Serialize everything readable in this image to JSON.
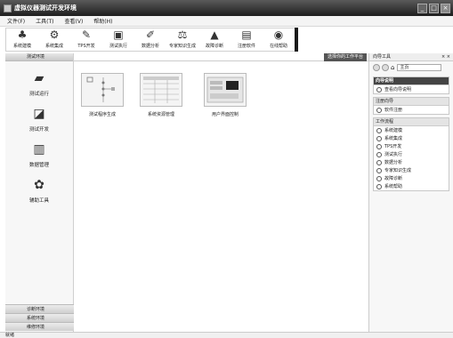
{
  "window": {
    "title": "虚拟仪器测试开发环境",
    "controls": [
      "_",
      "□",
      "×"
    ]
  },
  "menu": [
    "文件(F)",
    "工具(T)",
    "查看(V)",
    "帮助(H)"
  ],
  "toolbar": [
    {
      "label": "系统建模",
      "icon": "modeling-icon",
      "glyph": "♣"
    },
    {
      "label": "系统集成",
      "icon": "integration-icon",
      "glyph": "⚙"
    },
    {
      "label": "TPS开发",
      "icon": "tps-icon",
      "glyph": "✎"
    },
    {
      "label": "测试执行",
      "icon": "execute-icon",
      "glyph": "▣"
    },
    {
      "label": "数据分析",
      "icon": "analysis-icon",
      "glyph": "✐"
    },
    {
      "label": "专家知识生成",
      "icon": "expert-icon",
      "glyph": "⚖"
    },
    {
      "label": "故障诊断",
      "icon": "diagnosis-icon",
      "glyph": "▲"
    },
    {
      "label": "注册软件",
      "icon": "register-icon",
      "glyph": "▤"
    },
    {
      "label": "在线帮助",
      "icon": "help-icon",
      "glyph": "◉"
    }
  ],
  "sidebar": {
    "header": "测试环境",
    "items": [
      {
        "label": "测试运行",
        "icon": "run-icon",
        "glyph": "▰"
      },
      {
        "label": "测试开发",
        "icon": "develop-icon",
        "glyph": "◪"
      },
      {
        "label": "数据管理",
        "icon": "data-icon",
        "glyph": "▥"
      },
      {
        "label": "辅助工具",
        "icon": "tools-icon",
        "glyph": "✿"
      }
    ],
    "footers": [
      "诊断环境",
      "系统环境",
      "维修环境"
    ]
  },
  "main": {
    "tab": "选择你的工作平台",
    "cards": [
      "测试程序生成",
      "系统资源管理",
      "用户界面控制"
    ]
  },
  "tasks": {
    "header": "向导工具",
    "home_label": "主页",
    "wizard": {
      "title": "向导说明",
      "items": [
        "查看向导说明"
      ]
    },
    "register": {
      "title": "注册向导",
      "items": [
        "软件注册"
      ]
    },
    "flow": {
      "title": "工作流程",
      "items": [
        "系统建模",
        "系统集成",
        "TPS开发",
        "测试执行",
        "数据分析",
        "专家知识生成",
        "故障诊断",
        "系统帮助"
      ]
    }
  },
  "status": {
    "text": "就绪"
  }
}
